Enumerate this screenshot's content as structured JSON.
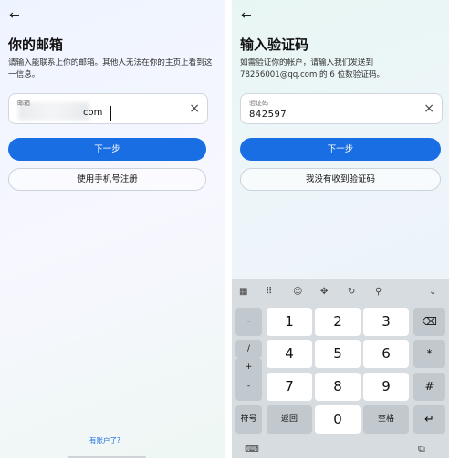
{
  "left_screen": {
    "back_icon": "←",
    "title": "你的邮箱",
    "description": "请输入能联系上你的邮箱。其他人无法在你的主页上看到这一信息。",
    "email_field": {
      "label": "邮箱",
      "value_suffix": "com",
      "clear_icon": "×"
    },
    "next_button": "下一步",
    "phone_signup_button": "使用手机号注册",
    "have_account_link": "有账户了?"
  },
  "right_screen": {
    "back_icon": "←",
    "title": "输入验证码",
    "description": "如需验证你的帐户，请输入我们发送到 78256001@qq.com 的 6 位数验证码。",
    "code_field": {
      "label": "验证码",
      "value": "842597",
      "clear_icon": "×"
    },
    "next_button": "下一步",
    "no_code_button": "我没有收到验证码",
    "keyboard": {
      "toolbar_icons": [
        "▦",
        "⠿",
        "☺",
        "✥",
        "↻",
        "⚲",
        "⌄"
      ],
      "side_keys": [
        "-",
        "/",
        "+",
        "-",
        "符号"
      ],
      "numbers": [
        "1",
        "2",
        "3",
        "4",
        "5",
        "6",
        "7",
        "8",
        "9",
        "0"
      ],
      "right_keys": [
        "⌫",
        "*",
        "#",
        "↵"
      ],
      "back_key": "返回",
      "space_key": "空格",
      "bottom_icons": [
        "⌨",
        "⧉"
      ]
    }
  }
}
